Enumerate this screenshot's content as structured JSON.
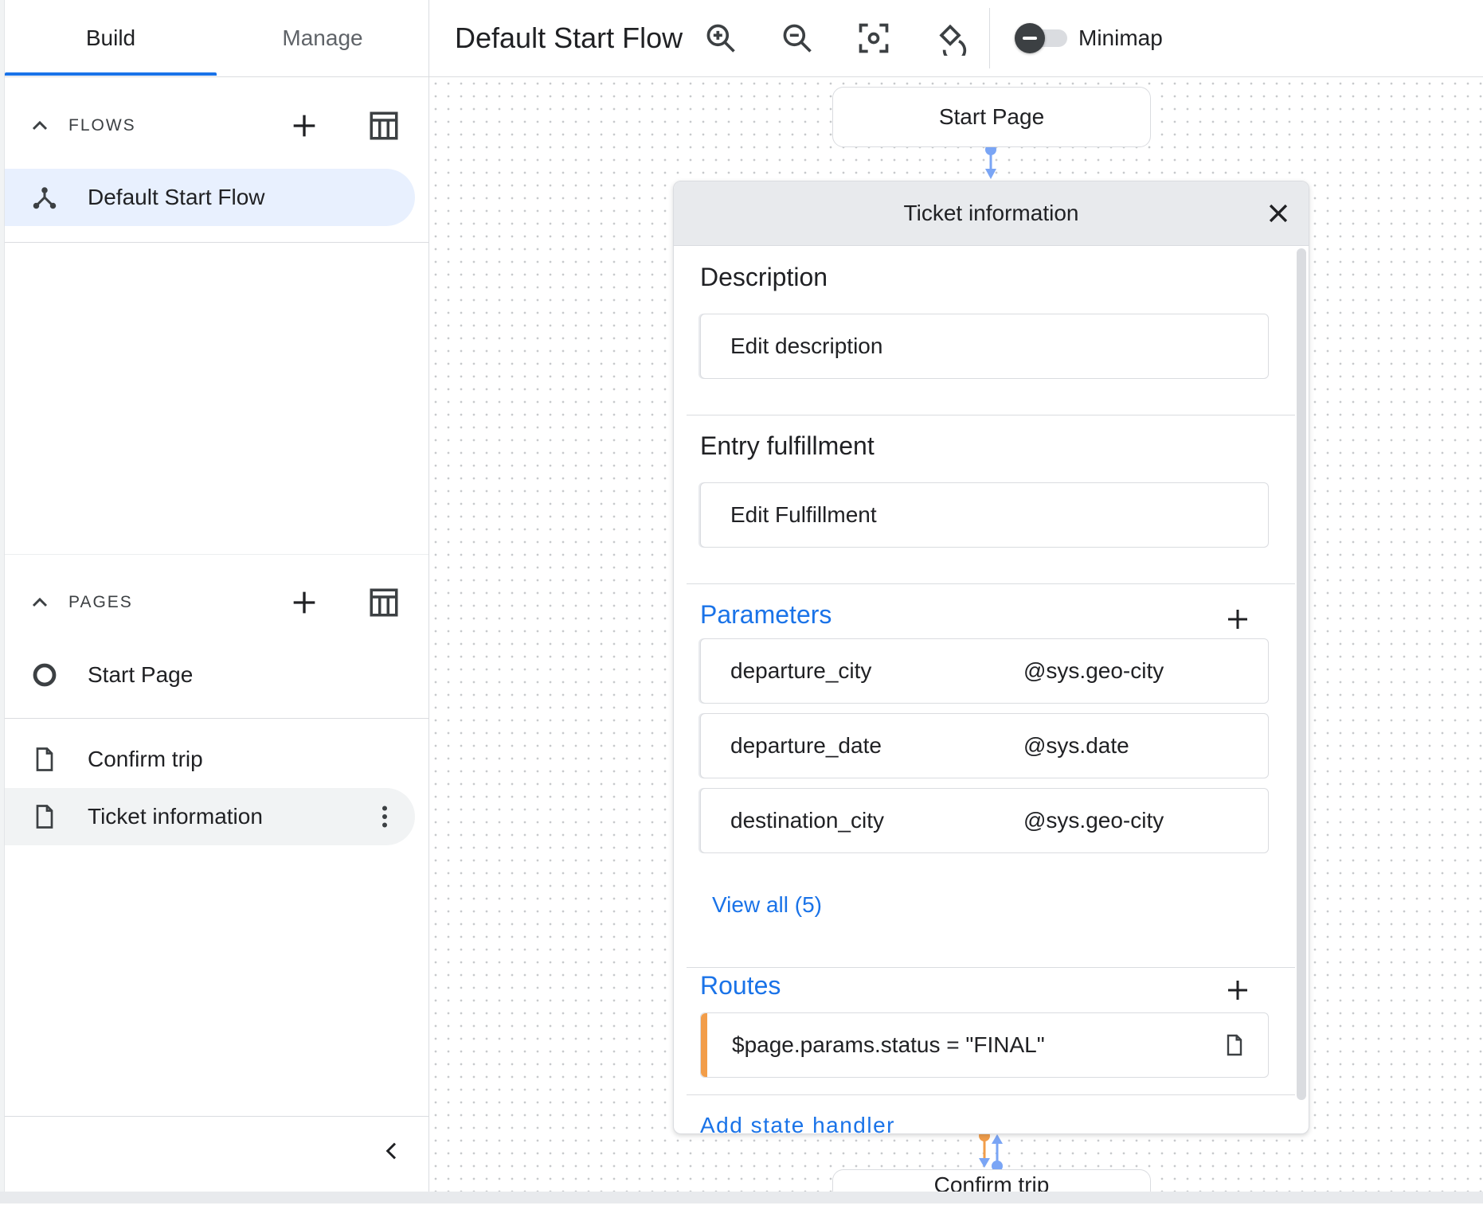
{
  "tabs": {
    "build": "Build",
    "manage": "Manage"
  },
  "flows": {
    "title": "FLOWS",
    "items": [
      {
        "label": "Default Start Flow"
      }
    ]
  },
  "pages": {
    "title": "PAGES",
    "items": [
      {
        "label": "Start Page"
      },
      {
        "label": "Confirm trip"
      },
      {
        "label": "Ticket information"
      }
    ]
  },
  "toolbar": {
    "title": "Default Start Flow",
    "minimap_label": "Minimap"
  },
  "canvas": {
    "start_node": "Start Page",
    "confirm_node": "Confirm trip"
  },
  "panel": {
    "title": "Ticket information",
    "description": {
      "heading": "Description",
      "button": "Edit description"
    },
    "entry": {
      "heading": "Entry fulfillment",
      "button": "Edit Fulfillment"
    },
    "parameters": {
      "heading": "Parameters",
      "items": [
        {
          "name": "departure_city",
          "type": "@sys.geo-city"
        },
        {
          "name": "departure_date",
          "type": "@sys.date"
        },
        {
          "name": "destination_city",
          "type": "@sys.geo-city"
        }
      ],
      "view_all": "View all (5)"
    },
    "routes": {
      "heading": "Routes",
      "items": [
        {
          "condition": "$page.params.status = \"FINAL\""
        }
      ]
    },
    "add_state_handler": "Add state handler"
  },
  "colors": {
    "accent": "#1a73e8",
    "selected_bg": "#e8f0fe",
    "route_accent": "#f29d49"
  }
}
